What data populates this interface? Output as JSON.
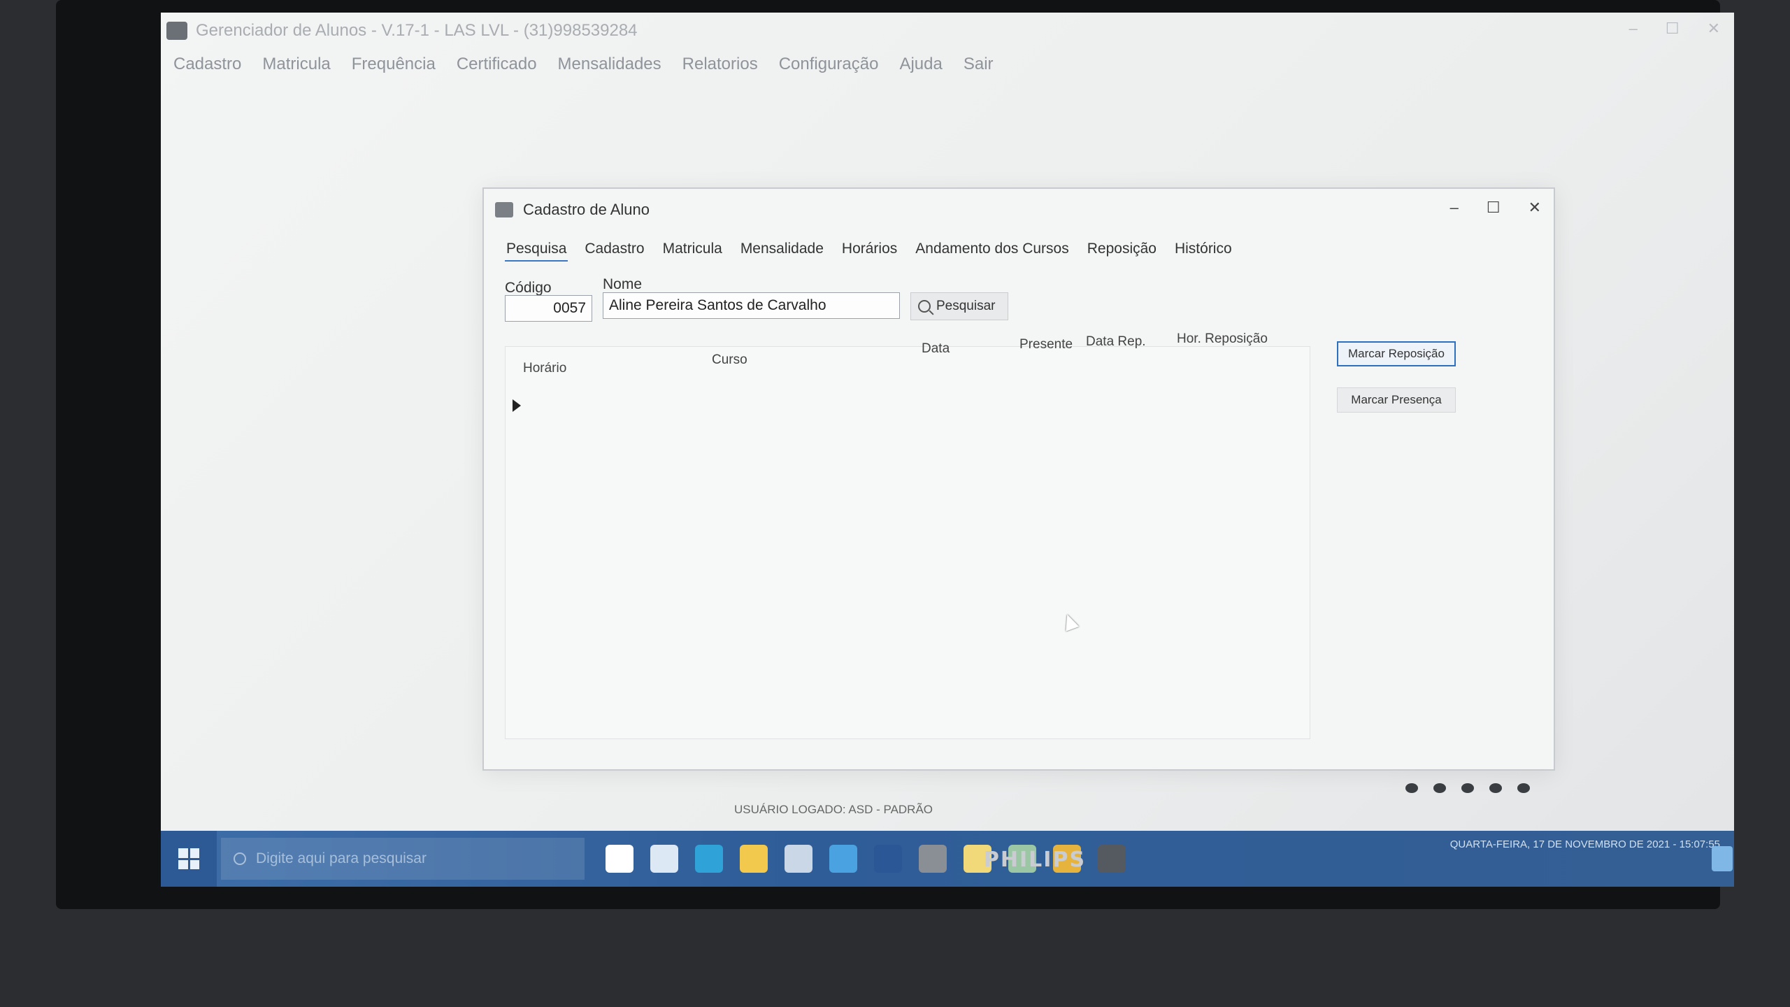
{
  "app": {
    "title": "Gerenciador de Alunos - V.17-1 - LAS LVL - (31)998539284",
    "menu": [
      "Cadastro",
      "Matricula",
      "Frequência",
      "Certificado",
      "Mensalidades",
      "Relatorios",
      "Configuração",
      "Ajuda",
      "Sair"
    ],
    "window_controls": [
      "–",
      "☐",
      "✕"
    ]
  },
  "dialog": {
    "title": "Cadastro de Aluno",
    "controls": [
      "–",
      "☐",
      "✕"
    ],
    "tabs": [
      "Pesquisa",
      "Cadastro",
      "Matricula",
      "Mensalidade",
      "Horários",
      "Andamento dos Cursos",
      "Reposição",
      "Histórico"
    ],
    "active_tab": "Pesquisa",
    "codigo_label": "Código",
    "codigo_value": "0057",
    "nome_label": "Nome",
    "nome_value": "Aline Pereira Santos de Carvalho",
    "search_label": "Pesquisar",
    "grid_columns": [
      "Horário",
      "Curso",
      "Data",
      "Presente",
      "Data Rep.",
      "Hor. Reposição"
    ],
    "mark_replacement_label": "Marcar Reposição",
    "mark_presence_label": "Marcar Presença"
  },
  "status": {
    "logged_user": "USUÁRIO LOGADO: ASD - PADRÃO"
  },
  "taskbar": {
    "search_placeholder": "Digite aqui para pesquisar",
    "tray_datetime": "QUARTA-FEIRA, 17 DE NOVEMBRO DE 2021 - 15:07:55",
    "apps": [
      {
        "name": "cortana-icon",
        "color": "#ffffff"
      },
      {
        "name": "task-view-icon",
        "color": "#dde8f5"
      },
      {
        "name": "edge-icon",
        "color": "#2fa3d8"
      },
      {
        "name": "file-explorer-icon",
        "color": "#f2c94c"
      },
      {
        "name": "store-icon",
        "color": "#c9d7e6"
      },
      {
        "name": "mail-icon",
        "color": "#4aa3e0"
      },
      {
        "name": "word-icon",
        "color": "#2b5797"
      },
      {
        "name": "student-manager-icon",
        "color": "#8a8f96"
      },
      {
        "name": "notes-icon",
        "color": "#f1d97a"
      },
      {
        "name": "paint-icon",
        "color": "#9cc7a4"
      },
      {
        "name": "chrome-icon",
        "color": "#e6b33c"
      },
      {
        "name": "app-icon",
        "color": "#555a61"
      }
    ]
  },
  "monitor": {
    "brand": "PHILIPS"
  }
}
